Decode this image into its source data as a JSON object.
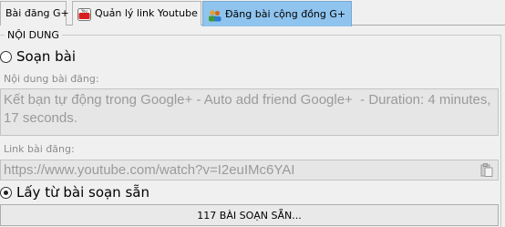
{
  "tabs": [
    {
      "label": "Bài đăng G+",
      "icon": "none"
    },
    {
      "label": "Quản lý link Youtube",
      "icon": "youtube-icon"
    },
    {
      "label": "Đăng bài cộng đồng G+",
      "icon": "community-icon",
      "active": true
    }
  ],
  "section": {
    "legend": "NỘI DUNG"
  },
  "compose": {
    "option_label": "Soạn bài",
    "selected": false,
    "content_label": "Nội dung bài đăng:",
    "content_value": "Kết bạn tự động trong Google+ - Auto add friend Google+  - Duration: 4 minutes, 17 seconds.",
    "link_label": "Link bài đăng:",
    "link_value": "https://www.youtube.com/watch?v=I2euIMc6YAI"
  },
  "prepared": {
    "option_label": "Lấy từ bài soạn sẵn",
    "selected": true,
    "button_label": "117 BÀI SOẠN SẴN..."
  },
  "colors": {
    "active_tab": "#8fc4ee",
    "disabled_field": "#e6e6e6"
  }
}
